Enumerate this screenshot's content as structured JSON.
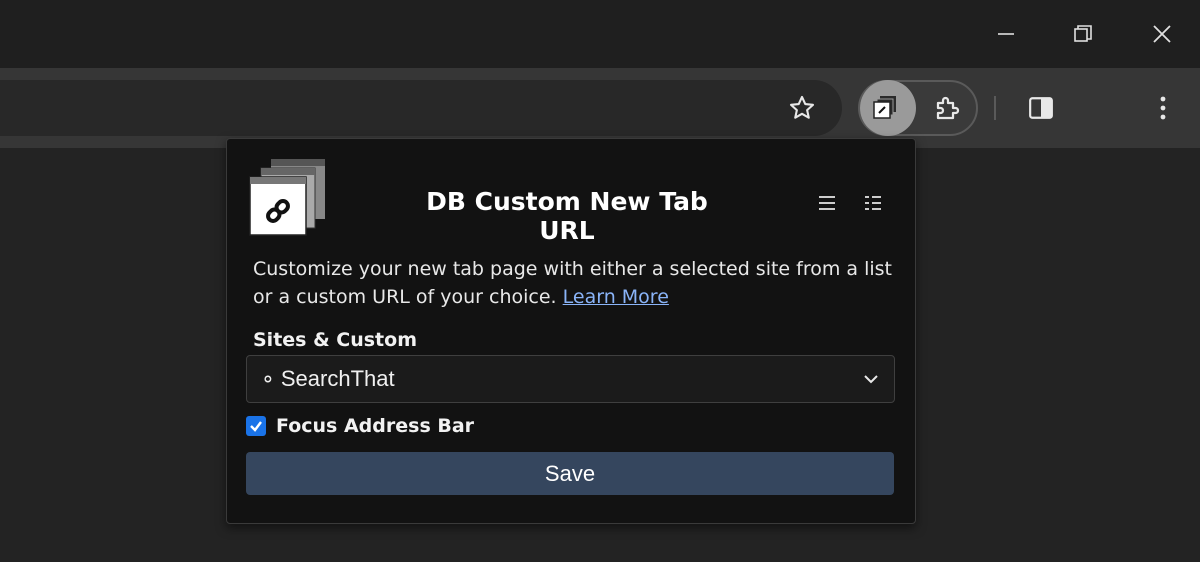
{
  "window": {
    "controls": [
      "minimize-icon",
      "restore-icon",
      "close-icon"
    ]
  },
  "toolbar": {
    "icons": [
      "bookmark-star-icon",
      "db-new-tab-extension-icon",
      "extensions-puzzle-icon",
      "side-panel-icon",
      "more-menu-icon"
    ]
  },
  "popup": {
    "title": "DB Custom New Tab URL",
    "description": "Customize your new tab page with either a selected site from a list or a custom URL of your choice.",
    "learn_more": "Learn More",
    "sites_label": "Sites & Custom",
    "selected_site": "∘ SearchThat",
    "focus_label": "Focus Address Bar",
    "focus_checked": true,
    "save_label": "Save",
    "accent_color": "#1a73e8",
    "save_color": "#35465e"
  }
}
